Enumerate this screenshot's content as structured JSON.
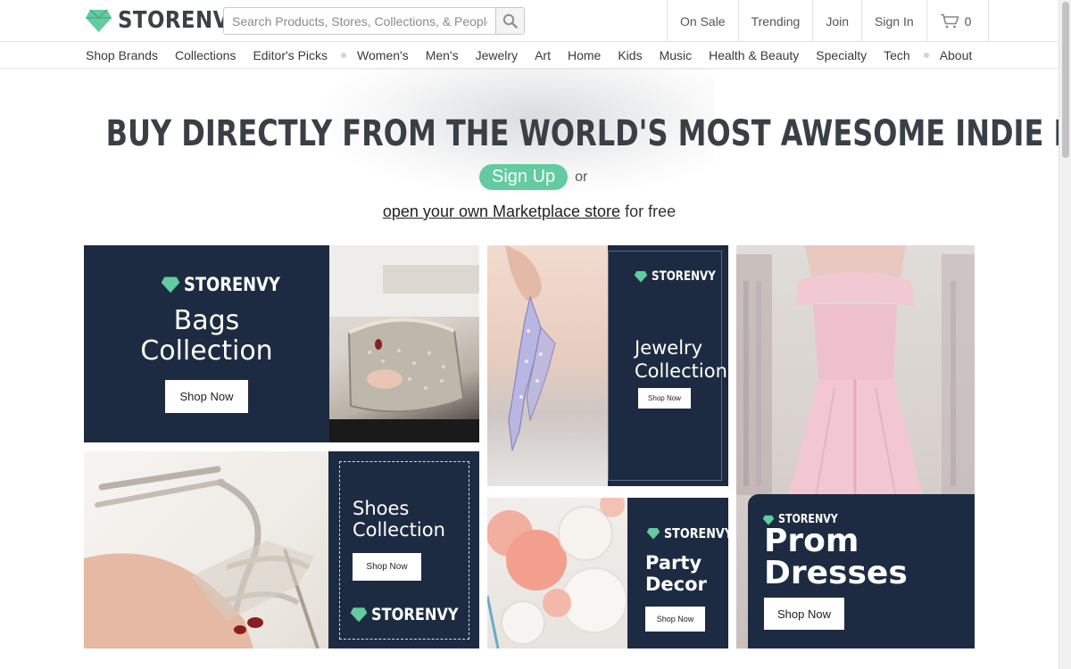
{
  "header": {
    "logo_text": "STORENVY",
    "search_placeholder": "Search Products, Stores, Collections, & People",
    "nav": [
      "On Sale",
      "Trending",
      "Join",
      "Sign In"
    ],
    "cart_count": "0"
  },
  "categories": {
    "group1": [
      "Shop Brands",
      "Collections",
      "Editor's Picks"
    ],
    "group2": [
      "Women's",
      "Men's",
      "Jewelry",
      "Art",
      "Home",
      "Kids",
      "Music",
      "Health & Beauty",
      "Specialty",
      "Tech"
    ],
    "group3": [
      "About"
    ]
  },
  "hero": {
    "headline": "BUY DIRECTLY FROM THE WORLD'S MOST AWESOME INDIE BRANDS.",
    "signup_label": "Sign Up",
    "or_text": "or",
    "market_link": "open your own Marketplace store",
    "market_suffix": "for free"
  },
  "tiles": {
    "bags": {
      "brand": "STORENVY",
      "title": [
        "Bags",
        "Collection"
      ],
      "button": "Shop Now"
    },
    "jewelry": {
      "brand": "STORENVY",
      "title": [
        "Jewelry",
        "Collection"
      ],
      "button": "Shop Now"
    },
    "prom": {
      "brand": "STORENVY",
      "title": [
        "Prom",
        "Dresses"
      ],
      "button": "Shop Now"
    },
    "shoes": {
      "brand": "STORENVY",
      "title": [
        "Shoes",
        "Collection"
      ],
      "button": "Shop Now"
    },
    "party": {
      "brand": "STORENVY",
      "title": [
        "Party",
        "Decor"
      ],
      "button": "Shop Now"
    }
  },
  "colors": {
    "brand_green": "#62cba0",
    "navy": "#1d2b42",
    "text_dark": "#3a3f46"
  }
}
